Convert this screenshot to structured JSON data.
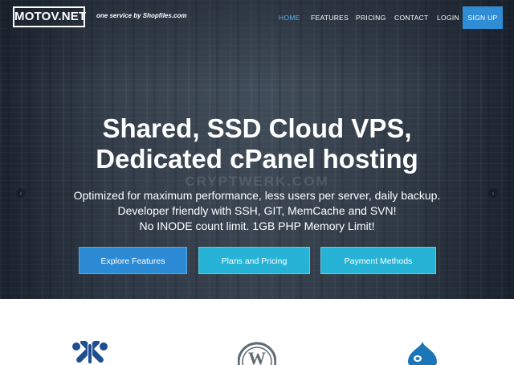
{
  "nav": {
    "logo": "MOTOV.NET",
    "tagline": "one service by Shopfiles.com",
    "items": [
      {
        "label": "HOME",
        "active": true
      },
      {
        "label": "FEATURES",
        "active": false
      },
      {
        "label": "PRICING",
        "active": false
      },
      {
        "label": "CONTACT",
        "active": false
      },
      {
        "label": "LOGIN",
        "active": false
      }
    ],
    "signup": "SIGN UP"
  },
  "hero": {
    "title_line1": "Shared, SSD Cloud VPS,",
    "title_line2": "Dedicated cPanel hosting",
    "sub_line1": "Optimized for maximum performance, less users per server, daily backup.",
    "sub_line2": "Developer friendly with SSH, GIT, MemCache and SVN!",
    "sub_line3": "No INODE count limit. 1GB PHP Memory Limit!",
    "watermark": "CRYPTWERK.COM",
    "buttons": [
      {
        "label": "Explore Features"
      },
      {
        "label": "Plans and Pricing"
      },
      {
        "label": "Payment Methods"
      }
    ],
    "prev_arrow": "‹",
    "next_arrow": "›"
  },
  "platforms": {
    "icons": [
      "joomla-icon",
      "wordpress-icon",
      "drupal-icon"
    ]
  },
  "colors": {
    "accent": "#2f8dd6",
    "button_blue": "#2d8ad4",
    "button_cyan": "#26b3d6",
    "active_nav": "#5ab4e8"
  }
}
